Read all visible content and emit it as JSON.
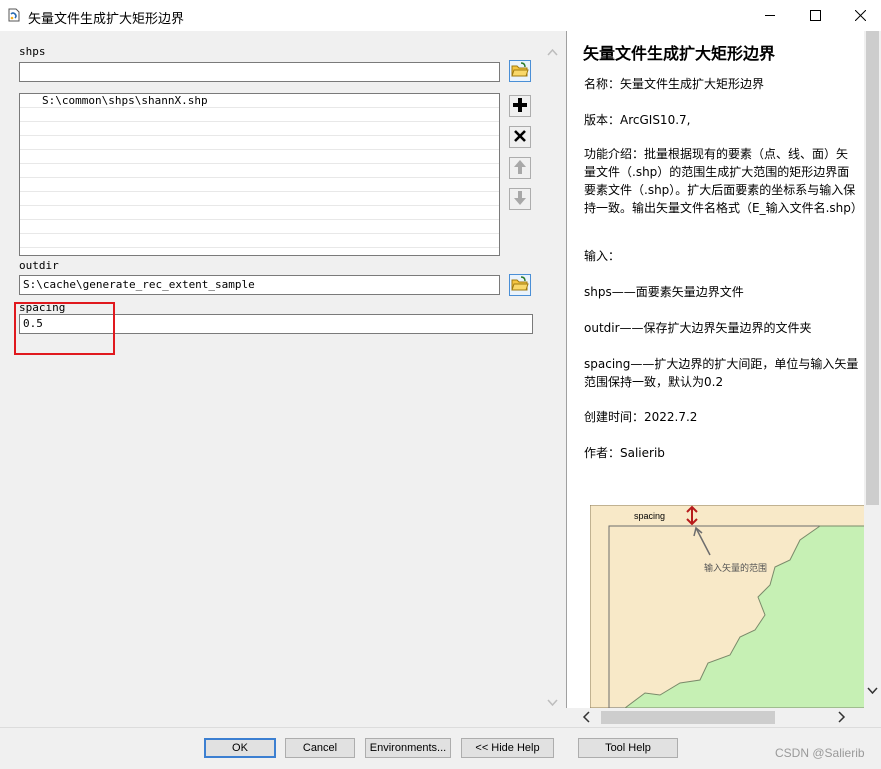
{
  "window": {
    "title": "矢量文件生成扩大矩形边界",
    "icon": "python-script-icon"
  },
  "form": {
    "shps_label": "shps",
    "shps_input_value": "",
    "shps_list": [
      "S:\\common\\shps\\shannX.shp",
      "",
      "",
      "",
      "",
      "",
      "",
      "",
      "",
      "",
      ""
    ],
    "outdir_label": "outdir",
    "outdir_value": "S:\\cache\\generate_rec_extent_sample",
    "spacing_label": "spacing",
    "spacing_value": "0.5"
  },
  "help": {
    "title": "矢量文件生成扩大矩形边界",
    "name_line": "名称：矢量文件生成扩大矩形边界",
    "version_line": "版本：ArcGIS10.7,",
    "intro_line": "功能介绍：批量根据现有的要素（点、线、面）矢量文件（.shp）的范围生成扩大范围的矩形边界面要素文件（.shp）。扩大后面要素的坐标系与输入保持一致。输出矢量文件名格式（E_输入文件名.shp）",
    "input_line": "输入：",
    "shps_desc": "shps——面要素矢量边界文件",
    "outdir_desc": "outdir——保存扩大边界矢量边界的文件夹",
    "spacing_desc": "spacing——扩大边界的扩大间距，单位与输入矢量范围保持一致，默认为0.2",
    "created_line": "创建时间：2022.7.2",
    "author_line": "作者：Salierib",
    "diagram_spacing_label": "spacing",
    "diagram_input_label": "输入矢量的范围"
  },
  "buttons": {
    "ok": "OK",
    "cancel": "Cancel",
    "environments": "Environments...",
    "hide_help": "<< Hide Help",
    "tool_help": "Tool Help"
  },
  "watermark": "CSDN @Salierib",
  "colors": {
    "highlight": "#e0191e",
    "diagram_bg": "#f8e9c8",
    "diagram_land": "#c6f0b4",
    "diagram_arrow": "#b71c1c"
  }
}
